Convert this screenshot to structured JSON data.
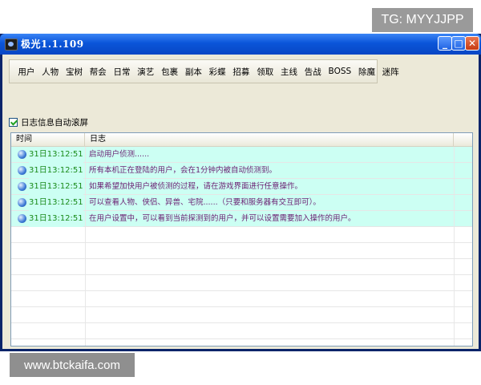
{
  "window": {
    "title": "极光1.1.109",
    "min_glyph": "_",
    "max_glyph": "□",
    "close_glyph": "✕"
  },
  "menu": [
    "用户",
    "人物",
    "宝树",
    "帮会",
    "日常",
    "演艺",
    "包裹",
    "副本",
    "彩蝶",
    "招募",
    "领取",
    "主线",
    "告战",
    "BOSS",
    "除魔",
    "迷阵"
  ],
  "options": {
    "autoscroll_label": "日志信息自动滚屏",
    "autoscroll_checked": true
  },
  "log": {
    "columns": {
      "time": "时间",
      "message": "日志"
    },
    "rows": [
      {
        "time": "31日13:12:51",
        "message": "启动用户侦测......"
      },
      {
        "time": "31日13:12:51",
        "message": "所有本机正在登陆的用户，会在1分钟内被自动侦测到。"
      },
      {
        "time": "31日13:12:51",
        "message": "如果希望加快用户被侦测的过程，请在游戏界面进行任意操作。"
      },
      {
        "time": "31日13:12:51",
        "message": "可以查看人物、侠侣、异兽、宅院......（只要和服务器有交互即可）。"
      },
      {
        "time": "31日13:12:51",
        "message": "在用户设置中，可以看到当前探测到的用户，并可以设置需要加入操作的用户。"
      }
    ],
    "empty_rows": 8,
    "row_color": "#ccfff3",
    "time_color": "#1a8a1a",
    "message_color": "#6a1e72"
  },
  "watermarks": {
    "top_right": "TG: MYYJJPP",
    "bottom_left": "www.btckaifa.com"
  }
}
